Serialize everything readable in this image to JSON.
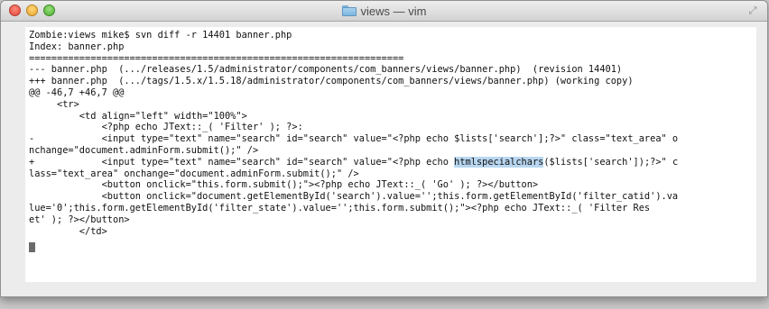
{
  "window": {
    "title": "views — vim",
    "colors": {
      "terminal_bg": "#ffffff",
      "text": "#111111",
      "highlight": "#b8d6f0"
    }
  },
  "terminal": {
    "lines": [
      "Zombie:views mike$ svn diff -r 14401 banner.php",
      "Index: banner.php",
      "===================================================================",
      "--- banner.php  (.../releases/1.5/administrator/components/com_banners/views/banner.php)  (revision 14401)",
      "+++ banner.php  (.../tags/1.5.x/1.5.18/administrator/components/com_banners/views/banner.php) (working copy)",
      "@@ -46,7 +46,7 @@",
      "     <tr>",
      "         <td align=\"left\" width=\"100%\">",
      "             <?php echo JText::_( 'Filter' ); ?>:",
      "-            <input type=\"text\" name=\"search\" id=\"search\" value=\"<?php echo $lists['search'];?>\" class=\"text_area\" o",
      "nchange=\"document.adminForm.submit();\" />"
    ],
    "changed_line": {
      "before": "+            <input type=\"text\" name=\"search\" id=\"search\" value=\"<?php echo ",
      "highlight": "htmlspecialchars",
      "after": "($lists['search']);?>\" c"
    },
    "lines_after": [
      "lass=\"text_area\" onchange=\"document.adminForm.submit();\" />",
      "             <button onclick=\"this.form.submit();\"><?php echo JText::_( 'Go' ); ?></button>",
      "             <button onclick=\"document.getElementById('search').value='';this.form.getElementById('filter_catid').va",
      "lue='0';this.form.getElementById('filter_state').value='';this.form.submit();\"><?php echo JText::_( 'Filter Res",
      "et' ); ?></button>",
      "         </td>"
    ]
  }
}
